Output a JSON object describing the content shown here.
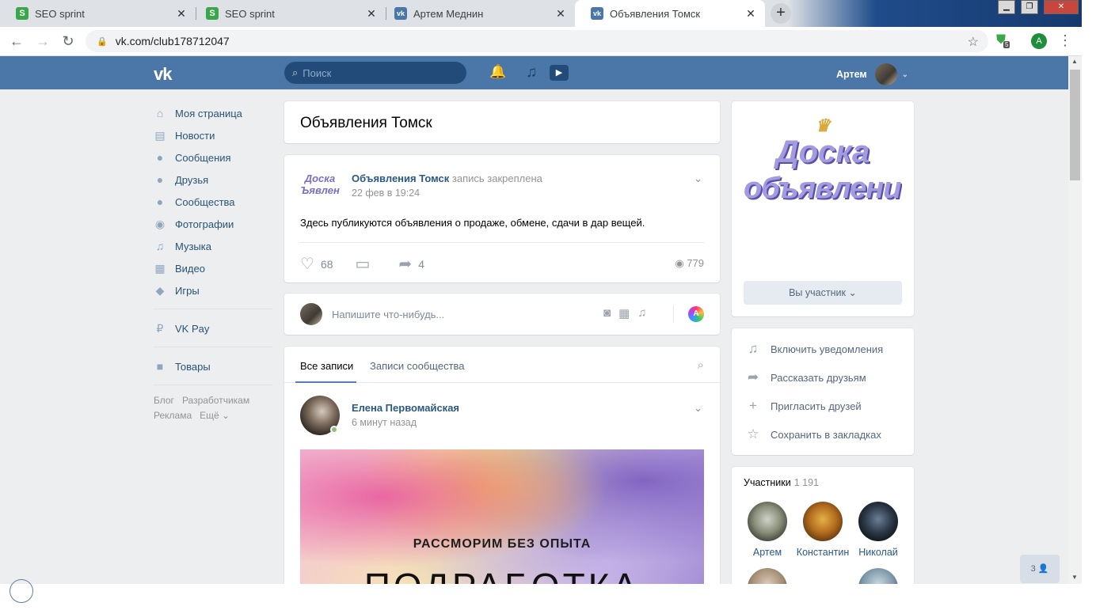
{
  "browser": {
    "tabs": [
      {
        "title": "SEO sprint",
        "favicon": "seo-sprint-icon",
        "active": false
      },
      {
        "title": "SEO sprint",
        "favicon": "seo-sprint-icon",
        "active": false
      },
      {
        "title": "Артем Меднин",
        "favicon": "vk-icon",
        "active": false
      },
      {
        "title": "Объявления Томск",
        "favicon": "vk-icon",
        "active": true
      }
    ],
    "new_tab": "+",
    "close_glyph": "✕",
    "url": "vk.com/club178712047",
    "profile_initial": "A",
    "ext_badge": "5",
    "window_buttons": {
      "minimize": "▁",
      "restore": "❐",
      "close": "✕"
    }
  },
  "vk": {
    "logo": "vk",
    "search_placeholder": "Поиск",
    "user_name": "Артем",
    "nav": [
      {
        "label": "Моя страница",
        "icon": "home-icon",
        "glyph": "⌂"
      },
      {
        "label": "Новости",
        "icon": "news-icon",
        "glyph": "▤"
      },
      {
        "label": "Сообщения",
        "icon": "messages-icon",
        "glyph": "●"
      },
      {
        "label": "Друзья",
        "icon": "friends-icon",
        "glyph": "●"
      },
      {
        "label": "Сообщества",
        "icon": "communities-icon",
        "glyph": "●"
      },
      {
        "label": "Фотографии",
        "icon": "camera-icon",
        "glyph": "◉"
      },
      {
        "label": "Музыка",
        "icon": "music-icon",
        "glyph": "♫"
      },
      {
        "label": "Видео",
        "icon": "video-icon",
        "glyph": "▦"
      },
      {
        "label": "Игры",
        "icon": "games-icon",
        "glyph": "◆"
      }
    ],
    "vkpay": {
      "label": "VK Pay",
      "glyph": "₽"
    },
    "goods": {
      "label": "Товары",
      "glyph": "■"
    },
    "footer": [
      "Блог",
      "Разработчикам",
      "Реклама",
      "Ещё ⌄"
    ],
    "group_title": "Объявления Томск",
    "pinned": {
      "group_avatar_text": "Доска Ъявлен",
      "author": "Объявления Томск",
      "pinned_label": "запись закреплена",
      "time": "22 фев в 19:24",
      "text": "Здесь публикуются объявления о продаже, обмене, сдачи в дар вещей.",
      "likes": "68",
      "shares": "4",
      "views": "779"
    },
    "composer_placeholder": "Напишите что-нибудь...",
    "feed": {
      "tab_all": "Все записи",
      "tab_community": "Записи сообщества",
      "post_author": "Елена Первомайская",
      "post_time": "6 минут назад",
      "image_line1": "РАССМОРИМ БЕЗ ОПЫТА",
      "image_line2": "ПОДРАБОТКА"
    },
    "cover": {
      "line1": "Доска",
      "line2": "объявлений",
      "member_button": "Вы участник ⌄"
    },
    "actions": [
      {
        "label": "Включить уведомления",
        "icon": "bell-icon",
        "glyph": "🔔"
      },
      {
        "label": "Рассказать друзьям",
        "icon": "share-icon",
        "glyph": "➦"
      },
      {
        "label": "Пригласить друзей",
        "icon": "invite-icon",
        "glyph": "+"
      },
      {
        "label": "Сохранить в закладках",
        "icon": "star-icon",
        "glyph": "☆"
      }
    ],
    "members": {
      "title": "Участники",
      "count": "1 191",
      "list": [
        "Артем",
        "Константин",
        "Николай"
      ]
    },
    "friends_badge": "3 👤",
    "colors": {
      "header": "#4a76a8",
      "link": "#2a5885",
      "bg": "#edeef0"
    }
  }
}
